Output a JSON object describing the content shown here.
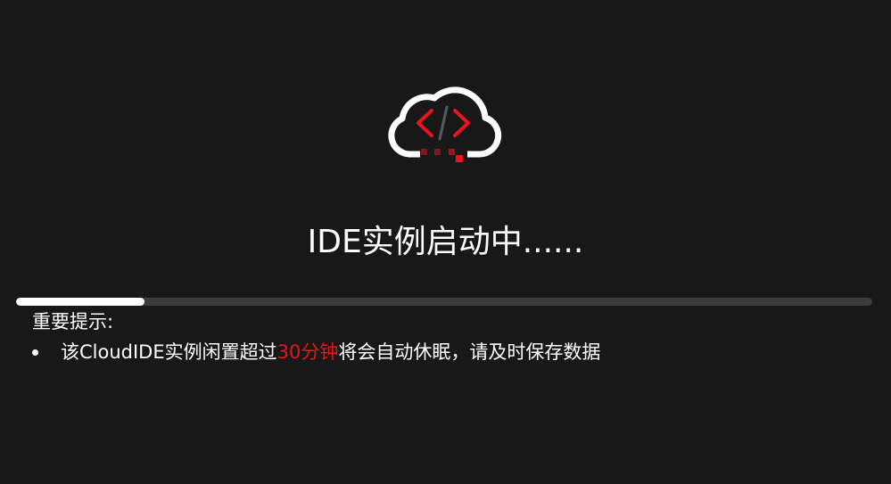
{
  "title": "IDE实例启动中......",
  "progress": {
    "percent": 15
  },
  "notice": {
    "heading": "重要提示:",
    "items": [
      {
        "before": "该CloudIDE实例闲置超过",
        "highlight": "30分钟",
        "after": "将会自动休眠，请及时保存数据"
      }
    ]
  },
  "colors": {
    "background": "#181818",
    "accent": "#e8141e",
    "track": "#3c3c3c",
    "fill": "#ffffff"
  },
  "icons": {
    "logo": "cloud-code-icon"
  }
}
